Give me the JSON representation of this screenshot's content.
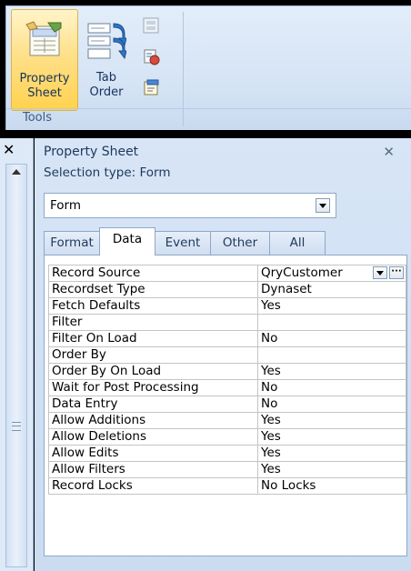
{
  "ribbon": {
    "property_sheet_label_1": "Property",
    "property_sheet_label_2": "Sheet",
    "tab_order_label_1": "Tab",
    "tab_order_label_2": "Order",
    "group_label": "Tools"
  },
  "pane": {
    "title": "Property Sheet",
    "close_glyph": "✕",
    "nav_close_glyph": "✕",
    "selection_type": "Selection type:  Form",
    "selector_value": "Form"
  },
  "tabs": [
    {
      "label": "Format",
      "active": false
    },
    {
      "label": "Data",
      "active": true
    },
    {
      "label": "Event",
      "active": false
    },
    {
      "label": "Other",
      "active": false
    },
    {
      "label": "All",
      "active": false
    }
  ],
  "properties": [
    {
      "name": "Record Source",
      "value": "QryCustomer"
    },
    {
      "name": "Recordset Type",
      "value": "Dynaset"
    },
    {
      "name": "Fetch Defaults",
      "value": "Yes"
    },
    {
      "name": "Filter",
      "value": ""
    },
    {
      "name": "Filter On Load",
      "value": "No"
    },
    {
      "name": "Order By",
      "value": ""
    },
    {
      "name": "Order By On Load",
      "value": "Yes"
    },
    {
      "name": "Wait for Post Processing",
      "value": "No"
    },
    {
      "name": "Data Entry",
      "value": "No"
    },
    {
      "name": "Allow Additions",
      "value": "Yes"
    },
    {
      "name": "Allow Deletions",
      "value": "Yes"
    },
    {
      "name": "Allow Edits",
      "value": "Yes"
    },
    {
      "name": "Allow Filters",
      "value": "Yes"
    },
    {
      "name": "Record Locks",
      "value": "No Locks"
    }
  ],
  "record_source_builder_glyph": "···"
}
